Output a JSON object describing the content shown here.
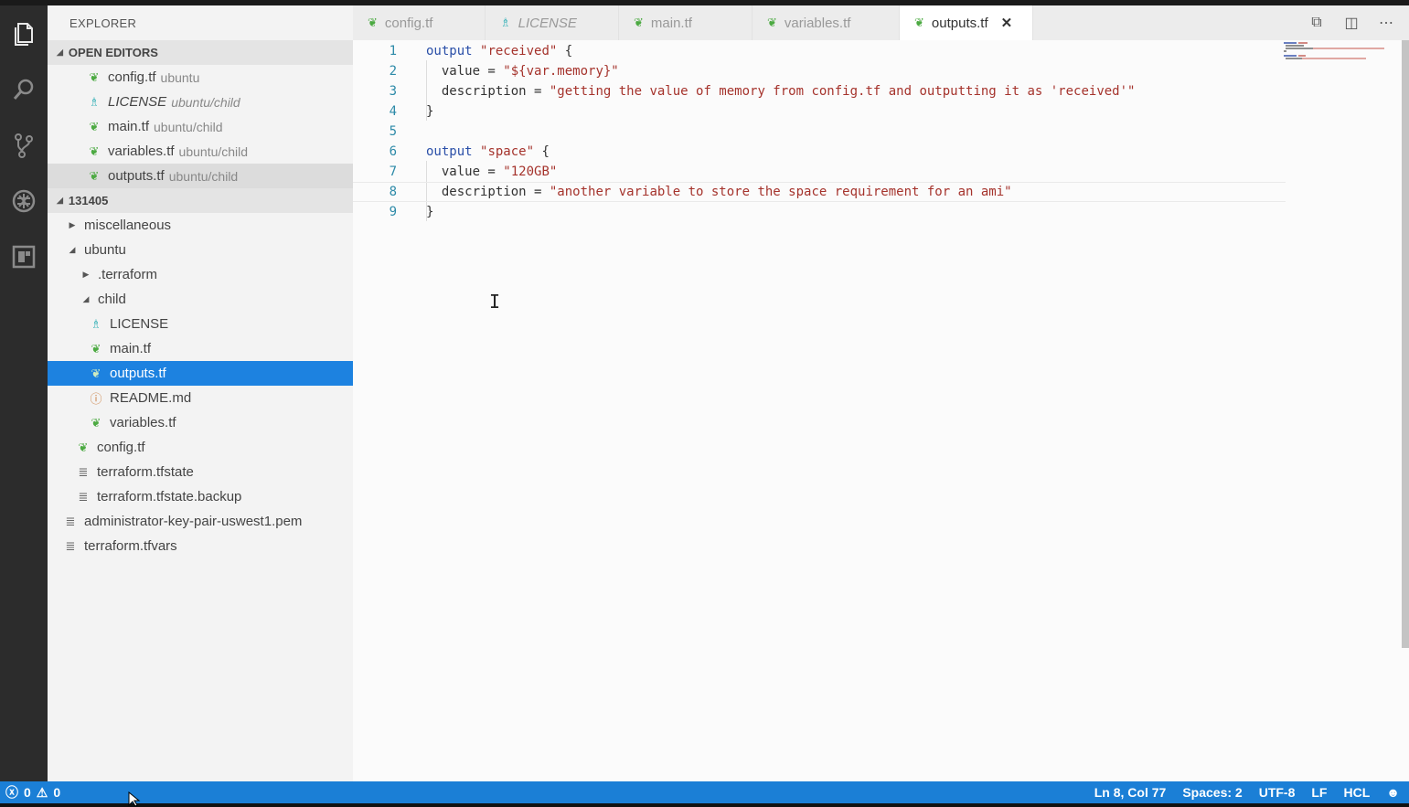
{
  "sidebar": {
    "title": "EXPLORER",
    "open_editors_label": "OPEN EDITORS",
    "open_editors": [
      {
        "name": "config.tf",
        "desc": "ubuntu",
        "icon": "terraform-icon"
      },
      {
        "name": "LICENSE",
        "desc": "ubuntu/child",
        "icon": "license-icon"
      },
      {
        "name": "main.tf",
        "desc": "ubuntu/child",
        "icon": "terraform-icon"
      },
      {
        "name": "variables.tf",
        "desc": "ubuntu/child",
        "icon": "terraform-icon"
      },
      {
        "name": "outputs.tf",
        "desc": "ubuntu/child",
        "icon": "terraform-icon"
      }
    ],
    "folder_label": "131405",
    "tree": [
      {
        "name": "miscellaneous",
        "type": "folder-collapsed"
      },
      {
        "name": "ubuntu",
        "type": "folder-expanded"
      },
      {
        "name": ".terraform",
        "type": "folder-collapsed"
      },
      {
        "name": "child",
        "type": "folder-expanded"
      },
      {
        "name": "LICENSE",
        "icon": "license-icon"
      },
      {
        "name": "main.tf",
        "icon": "terraform-icon"
      },
      {
        "name": "outputs.tf",
        "icon": "terraform-icon"
      },
      {
        "name": "README.md",
        "icon": "info-icon"
      },
      {
        "name": "variables.tf",
        "icon": "terraform-icon"
      },
      {
        "name": "config.tf",
        "icon": "terraform-icon"
      },
      {
        "name": "terraform.tfstate",
        "icon": "lines-icon"
      },
      {
        "name": "terraform.tfstate.backup",
        "icon": "lines-icon"
      },
      {
        "name": "administrator-key-pair-uswest1.pem",
        "icon": "lines-icon"
      },
      {
        "name": "terraform.tfvars",
        "icon": "lines-icon"
      }
    ]
  },
  "tabs": [
    {
      "label": "config.tf",
      "icon": "terraform-icon"
    },
    {
      "label": "LICENSE",
      "icon": "license-icon"
    },
    {
      "label": "main.tf",
      "icon": "terraform-icon"
    },
    {
      "label": "variables.tf",
      "icon": "terraform-icon"
    },
    {
      "label": "outputs.tf",
      "icon": "terraform-icon",
      "active": true
    }
  ],
  "editor": {
    "line_numbers": [
      "1",
      "2",
      "3",
      "4",
      "5",
      "6",
      "7",
      "8",
      "9"
    ],
    "lines": [
      {
        "kw": "output",
        "str": "\"received\"",
        "rest": " {"
      },
      {
        "indent": "  ",
        "key": "value = ",
        "str": "\"${var.memory}\""
      },
      {
        "indent": "  ",
        "key": "description = ",
        "str": "\"getting the value of memory from config.tf and outputting it as 'received'\""
      },
      {
        "text": "}"
      },
      {
        "text": ""
      },
      {
        "kw": "output",
        "str": "\"space\"",
        "rest": " {"
      },
      {
        "indent": "  ",
        "key": "value = ",
        "str": "\"120GB\""
      },
      {
        "indent": "  ",
        "key": "description = ",
        "str": "\"another variable to store the space requirement for an ami\""
      },
      {
        "text": "}"
      }
    ]
  },
  "status": {
    "errors": "0",
    "warnings": "0",
    "position": "Ln 8, Col 77",
    "spaces": "Spaces: 2",
    "encoding": "UTF-8",
    "eol": "LF",
    "language": "HCL"
  },
  "colors": {
    "status_bar": "#1b7fd6",
    "selection": "#1d82e0",
    "terraform_icon": "#4caa42"
  }
}
